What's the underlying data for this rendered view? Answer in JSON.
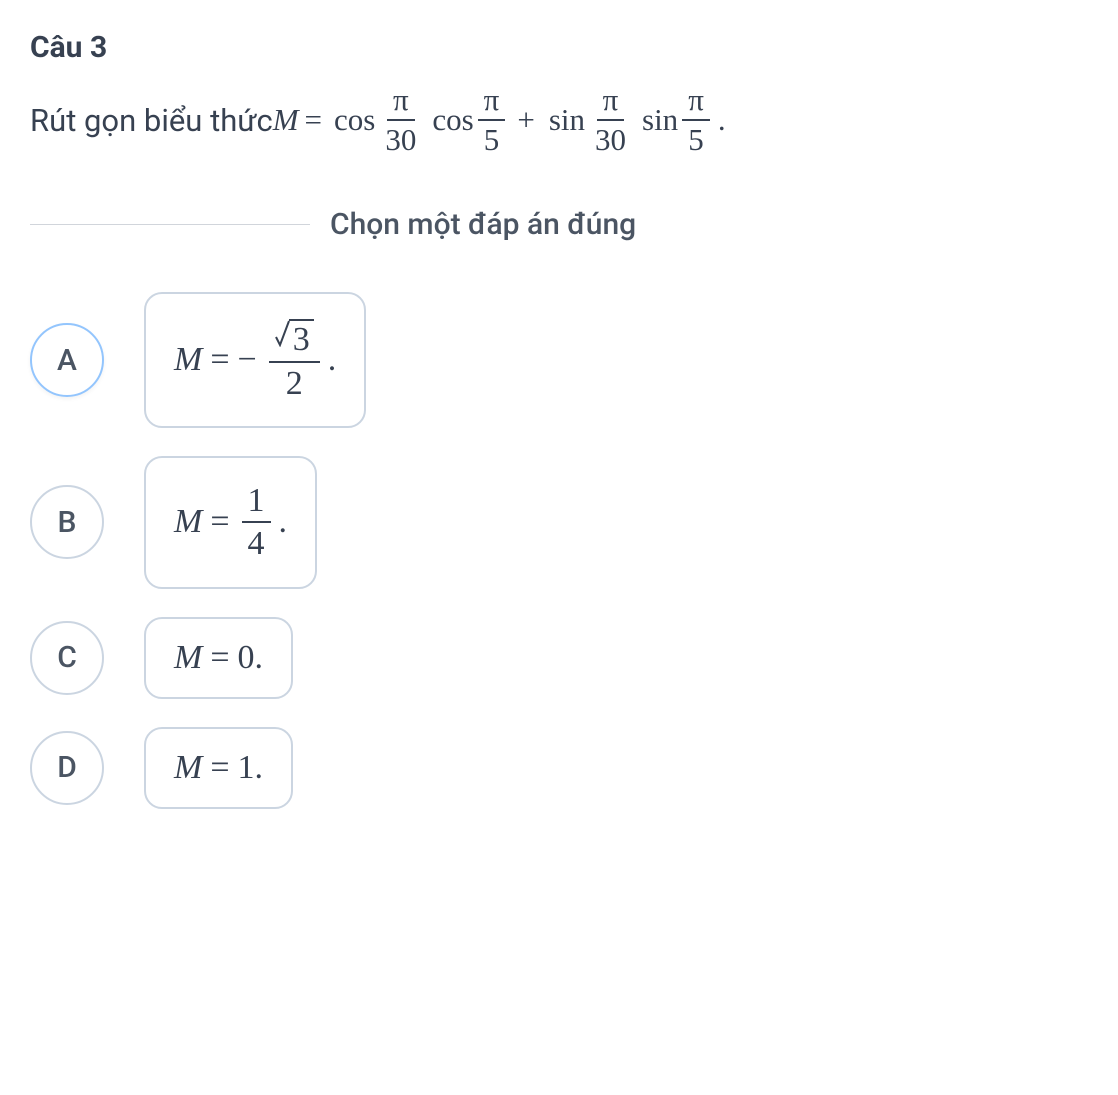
{
  "question": {
    "number": "Câu 3",
    "text_prefix": "Rút gọn biểu thức ",
    "variable": "M",
    "equals": "=",
    "fn_cos": "cos",
    "fn_sin": "sin",
    "plus": "+",
    "dot": ".",
    "pi": "π",
    "den30": "30",
    "den5": "5"
  },
  "instruction": "Chọn một đáp án đúng",
  "options": {
    "A": {
      "letter": "A",
      "variable": "M",
      "equals": "=",
      "minus": "−",
      "sqrt_val": "3",
      "den": "2",
      "dot": "."
    },
    "B": {
      "letter": "B",
      "variable": "M",
      "equals": "=",
      "num": "1",
      "den": "4",
      "dot": "."
    },
    "C": {
      "letter": "C",
      "variable": "M",
      "equals": "=",
      "value": "0",
      "dot": "."
    },
    "D": {
      "letter": "D",
      "variable": "M",
      "equals": "=",
      "value": "1",
      "dot": "."
    }
  }
}
